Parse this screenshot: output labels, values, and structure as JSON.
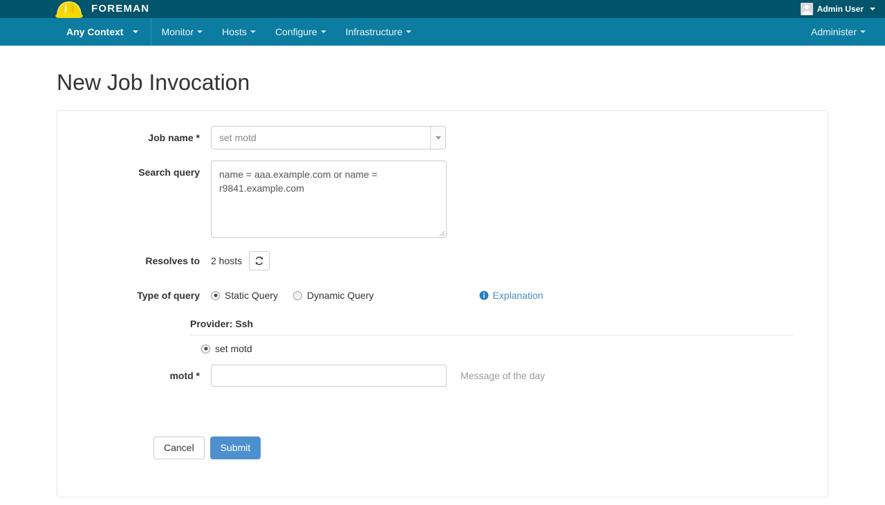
{
  "brand": {
    "name": "FOREMAN",
    "logo_icon": "hardhat-icon",
    "user_name": "Admin User",
    "user_avatar_icon": "user-avatar-icon",
    "user_caret_icon": "caret-down-icon"
  },
  "nav": {
    "context_label": "Any Context",
    "items": [
      {
        "label": "Monitor"
      },
      {
        "label": "Hosts"
      },
      {
        "label": "Configure"
      },
      {
        "label": "Infrastructure"
      }
    ],
    "right_items": [
      {
        "label": "Administer"
      }
    ]
  },
  "page": {
    "title": "New Job Invocation"
  },
  "form": {
    "job_name": {
      "label": "Job name *",
      "value": "set motd",
      "dropdown_icon": "chevron-down-icon"
    },
    "search_query": {
      "label": "Search query",
      "value": "name = aaa.example.com or name = r9841.example.com"
    },
    "resolves_to": {
      "label": "Resolves to",
      "value": "2 hosts",
      "refresh_icon": "refresh-icon"
    },
    "type_of_query": {
      "label": "Type of query",
      "options": [
        {
          "label": "Static Query",
          "selected": true
        },
        {
          "label": "Dynamic Query",
          "selected": false
        }
      ],
      "explanation_label": "Explanation",
      "explanation_icon": "info-circle-icon"
    },
    "provider": {
      "title": "Provider: Ssh",
      "template_option": {
        "label": "set motd",
        "selected": true
      },
      "motd": {
        "label": "motd *",
        "value": "",
        "help": "Message of the day"
      }
    },
    "actions": {
      "cancel_label": "Cancel",
      "submit_label": "Submit"
    }
  },
  "colors": {
    "brandbar": "#00546b",
    "navbar": "#0d7ca1",
    "primary_button": "#4d90cd",
    "link": "#4a8ec2",
    "hardhat": "#f5d900"
  }
}
